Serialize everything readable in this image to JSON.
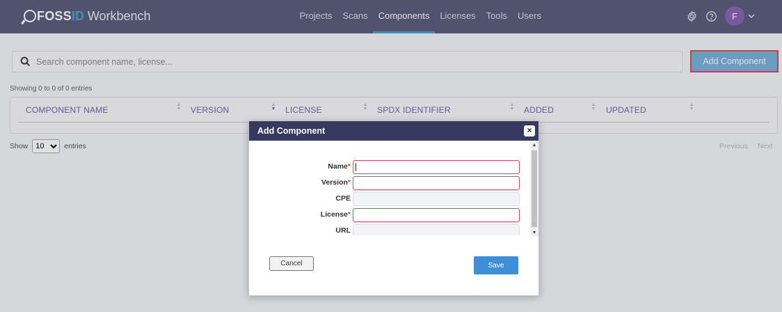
{
  "app": {
    "logo_foss": "FOSS",
    "logo_id": "ID",
    "logo_workbench": "Workbench"
  },
  "nav": {
    "items": [
      {
        "label": "Projects"
      },
      {
        "label": "Scans"
      },
      {
        "label": "Components",
        "active": true
      },
      {
        "label": "Licenses"
      },
      {
        "label": "Tools"
      },
      {
        "label": "Users"
      }
    ]
  },
  "user": {
    "avatar_initial": "F"
  },
  "icons": {
    "settings": "gear-icon",
    "help": "help-circle-icon",
    "user_menu": "chevron-down-icon",
    "search": "search-icon",
    "close": "close-icon"
  },
  "search": {
    "placeholder": "Search component name, license..."
  },
  "toolbar": {
    "add_component_label": "Add Component"
  },
  "table": {
    "info": "Showing 0 to 0 of 0 entries",
    "columns": [
      "COMPONENT NAME",
      "VERSION",
      "LICENSE",
      "SPDX IDENTIFIER",
      "ADDED",
      "UPDATED"
    ],
    "show_prefix": "Show",
    "page_size": "10",
    "show_suffix": "entries",
    "previous_label": "Previous",
    "next_label": "Next"
  },
  "modal": {
    "title": "Add Component",
    "close_label": "×",
    "fields": [
      {
        "label": "Name",
        "required": true,
        "value": ""
      },
      {
        "label": "Version",
        "required": true,
        "value": ""
      },
      {
        "label": "CPE",
        "required": false,
        "value": ""
      },
      {
        "label": "License",
        "required": true,
        "value": ""
      },
      {
        "label": "URL",
        "required": false,
        "value": ""
      }
    ],
    "required_marker": "*",
    "cancel_label": "Cancel",
    "save_label": "Save"
  },
  "colors": {
    "topbar": "#5c5e7e",
    "accent": "#4aa6d9",
    "modal_header": "#373a5e",
    "save_button": "#3e8fd6",
    "add_button": "#7cb3dc",
    "highlight": "#e04860",
    "required_border": "#e0474a"
  }
}
